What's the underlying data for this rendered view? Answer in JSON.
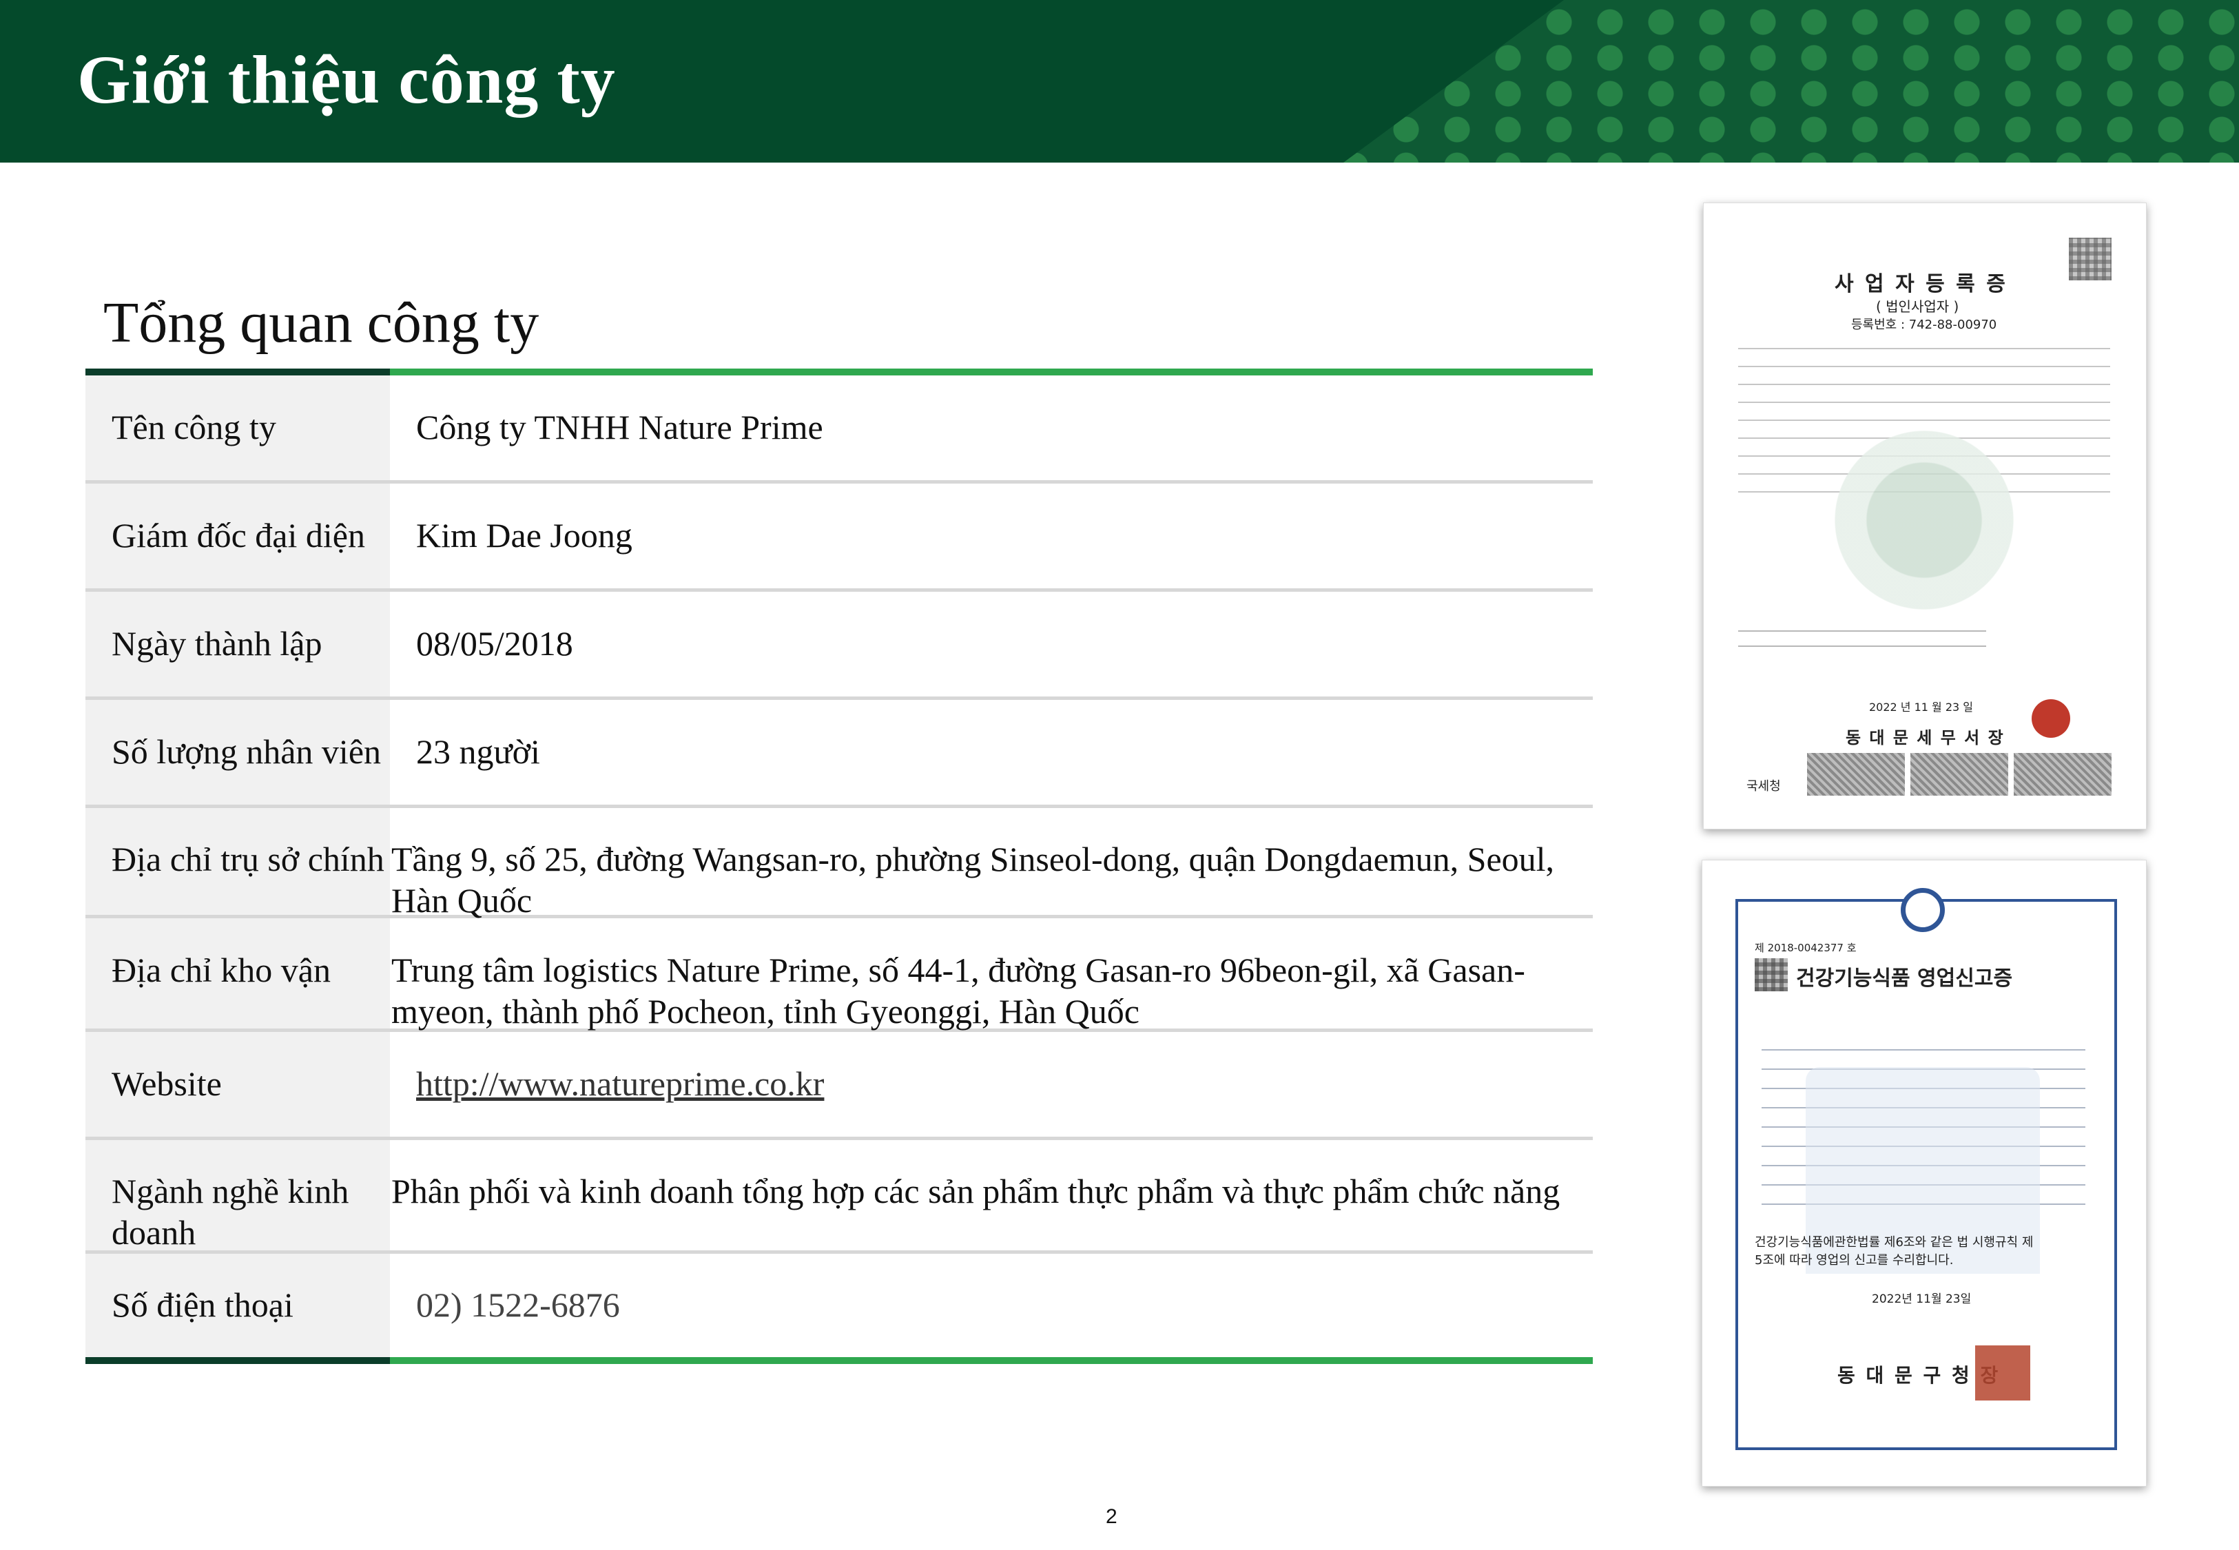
{
  "header": {
    "title": "Giới thiệu công ty"
  },
  "section": {
    "title": "Tổng quan công ty"
  },
  "rows": [
    {
      "label": "Tên công ty",
      "value": "Công ty TNHH Nature Prime"
    },
    {
      "label": "Giám đốc đại diện",
      "value": "Kim Dae Joong"
    },
    {
      "label": "Ngày thành lập",
      "value": "08/05/2018"
    },
    {
      "label": "Số lượng nhân viên",
      "value": "23 người"
    },
    {
      "label": "Địa chỉ trụ sở chính",
      "value_line1": "Tầng 9, số 25, đường Wangsan-ro, phường Sinseol-dong, quận Dongdaemun, Seoul,",
      "value_line2": "Hàn Quốc"
    },
    {
      "label": "Địa chỉ kho vận",
      "value_line1": "Trung tâm logistics Nature Prime, số 44-1, đường Gasan-ro 96beon-gil, xã Gasan-",
      "value_line2": "myeon, thành phố Pocheon, tỉnh Gyeonggi, Hàn Quốc"
    },
    {
      "label": "Website",
      "value": "http://www.natureprime.co.kr"
    },
    {
      "label_line1": "Ngành nghề kinh",
      "label_line2": "doanh",
      "value": "Phân phối và kinh doanh tổng hợp các sản phẩm thực phẩm và thực phẩm chức năng"
    },
    {
      "label": "Số điện thoại",
      "value": "02) 1522-6876"
    }
  ],
  "certificates": {
    "business_registration": {
      "title": "사 업 자 등 록 증",
      "subtitle": "( 법인사업자 )",
      "reg_no": "등록번호 : 742-88-00970",
      "date": "2022 년 11 월 23 일",
      "issuer": "동 대 문 세 무 서 장",
      "agency": "국세청"
    },
    "health_food_report": {
      "number": "제 2018-0042377 호",
      "title": "건강기능식품 영업신고증",
      "body_line1": "건강기능식품에관한법률 제6조와 같은 법 시행규칙 제",
      "body_line2": "5조에 따라 영업의 신고를 수리합니다.",
      "date": "2022년 11월 23일",
      "issuer": "동 대 문 구 청 장"
    }
  },
  "footer": {
    "page_number": "2"
  },
  "colors": {
    "banner": "#044a2b",
    "accent_green": "#2fa84f",
    "label_bg": "#f1f1f1"
  }
}
